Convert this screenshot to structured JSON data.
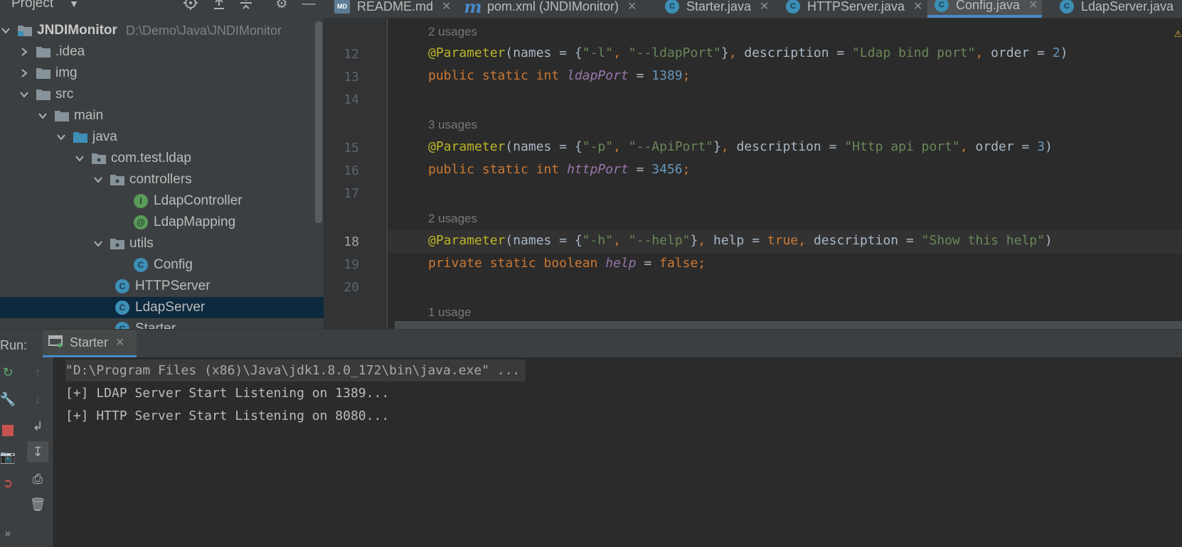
{
  "project_panel": {
    "title": "Project",
    "tree": [
      {
        "label": "JNDIMonitor",
        "path": "D:\\Demo\\Java\\JNDIMonitor",
        "type": "module",
        "depth": 0,
        "expanded": true
      },
      {
        "label": ".idea",
        "type": "folder",
        "depth": 1,
        "expanded": false
      },
      {
        "label": "img",
        "type": "folder",
        "depth": 1,
        "expanded": false
      },
      {
        "label": "src",
        "type": "folder",
        "depth": 1,
        "expanded": true
      },
      {
        "label": "main",
        "type": "folder",
        "depth": 2,
        "expanded": true
      },
      {
        "label": "java",
        "type": "source-folder",
        "depth": 3,
        "expanded": true
      },
      {
        "label": "com.test.ldap",
        "type": "package",
        "depth": 4,
        "expanded": true
      },
      {
        "label": "controllers",
        "type": "package",
        "depth": 5,
        "expanded": true
      },
      {
        "label": "LdapController",
        "type": "interface",
        "depth": 6
      },
      {
        "label": "LdapMapping",
        "type": "annotation",
        "depth": 6
      },
      {
        "label": "utils",
        "type": "package",
        "depth": 5,
        "expanded": true
      },
      {
        "label": "Config",
        "type": "class",
        "depth": 6
      },
      {
        "label": "HTTPServer",
        "type": "class",
        "depth": 5
      },
      {
        "label": "LdapServer",
        "type": "class",
        "depth": 5,
        "selected": true
      },
      {
        "label": "Starter",
        "type": "class",
        "depth": 5
      }
    ]
  },
  "tabs": [
    {
      "label": "README.md",
      "icon": "markdown-icon"
    },
    {
      "label": "pom.xml (JNDIMonitor)",
      "icon": "maven-icon"
    },
    {
      "label": "Starter.java",
      "icon": "class-icon"
    },
    {
      "label": "HTTPServer.java",
      "icon": "class-icon"
    },
    {
      "label": "Config.java",
      "icon": "class-icon",
      "active": true
    },
    {
      "label": "LdapServer.java",
      "icon": "class-icon"
    }
  ],
  "editor": {
    "usages": [
      "2 usages",
      "3 usages",
      "2 usages",
      "1 usage"
    ],
    "line_numbers": [
      "12",
      "13",
      "14",
      "15",
      "16",
      "17",
      "18",
      "19",
      "20"
    ],
    "current_line": "18",
    "code": {
      "l12": {
        "ann": "@Parameter",
        "p1": "(names = {",
        "s1": "\"-l\"",
        "c1": ", ",
        "s2": "\"--ldapPort\"",
        "p2": "}",
        "c2": ", ",
        "p3": "description = ",
        "s3": "\"Ldap bind port\"",
        "c3": ", ",
        "p4": "order = ",
        "n1": "2",
        "p5": ")"
      },
      "l13": {
        "k1": "public static int ",
        "f": "ldapPort",
        "p1": " = ",
        "n": "1389",
        "k2": ";"
      },
      "l15": {
        "ann": "@Parameter",
        "p1": "(names = {",
        "s1": "\"-p\"",
        "c1": ", ",
        "s2": "\"--ApiPort\"",
        "p2": "}",
        "c2": ", ",
        "p3": "description = ",
        "s3": "\"Http api port\"",
        "c3": ", ",
        "p4": "order = ",
        "n1": "3",
        "p5": ")"
      },
      "l16": {
        "k1": "public static int ",
        "f": "httpPort",
        "p1": " = ",
        "n": "3456",
        "k2": ";"
      },
      "l18": {
        "ann": "@Parameter",
        "p1": "(names = {",
        "s1": "\"-h\"",
        "c1": ", ",
        "s2": "\"--help\"",
        "p2": "}",
        "c2": ", ",
        "p3": "help = ",
        "k": "true",
        "c3": ", ",
        "p4": "description = ",
        "s3": "\"Show this help\"",
        "p5": ")"
      },
      "l19": {
        "k1": "private static boolean ",
        "f": "help",
        "p1": " = ",
        "k": "false",
        "k2": ";"
      }
    }
  },
  "run_panel": {
    "label": "Run:",
    "tab_label": "Starter",
    "console": [
      "\"D:\\Program Files (x86)\\Java\\jdk1.8.0_172\\bin\\java.exe\" ...",
      "[+] LDAP Server Start Listening on 1389...",
      "[+] HTTP Server Start Listening on 8080..."
    ]
  },
  "colors": {
    "keyword": "#cc7832",
    "string": "#6a8759",
    "number": "#6897bb",
    "annotation": "#bbb529",
    "field": "#9876aa",
    "accent": "#4a88c7"
  }
}
